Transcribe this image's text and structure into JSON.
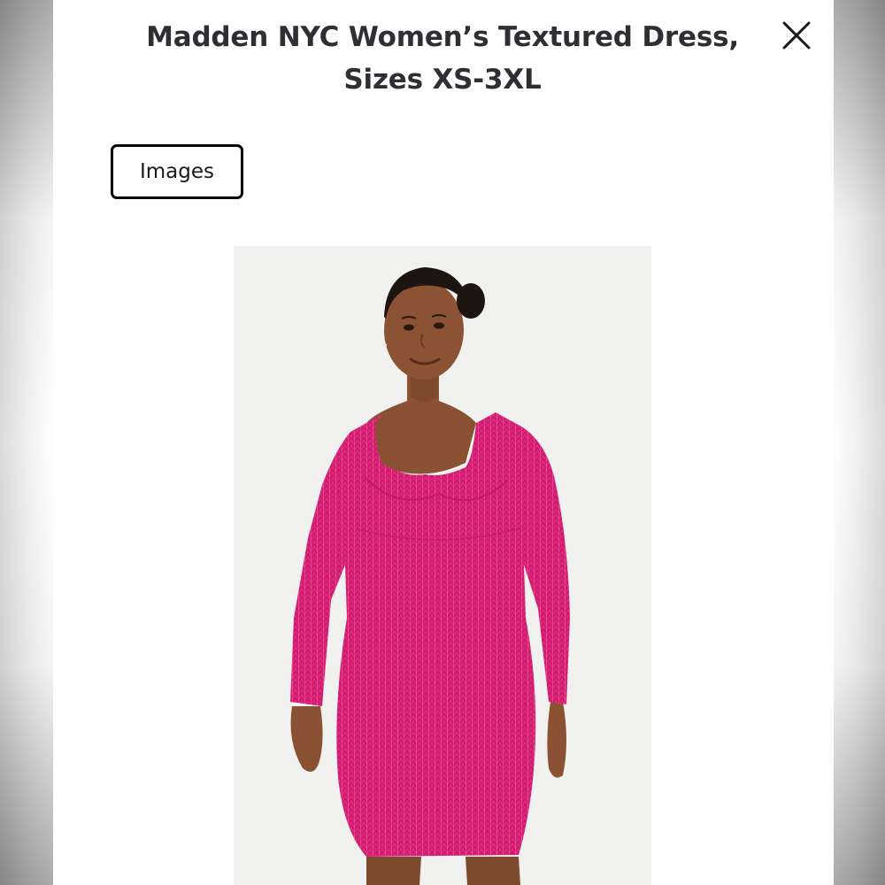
{
  "product": {
    "title_line1": "Madden NYC Women’s Textured Dress,",
    "title_line2": "Sizes XS-3XL"
  },
  "tabs": {
    "images_label": "Images"
  },
  "icons": {
    "close": "close-icon"
  },
  "colors": {
    "title_text": "#2e2f32",
    "dress_pink": "#e1257d",
    "image_background": "#f1f1f0",
    "tab_border": "#000000"
  }
}
